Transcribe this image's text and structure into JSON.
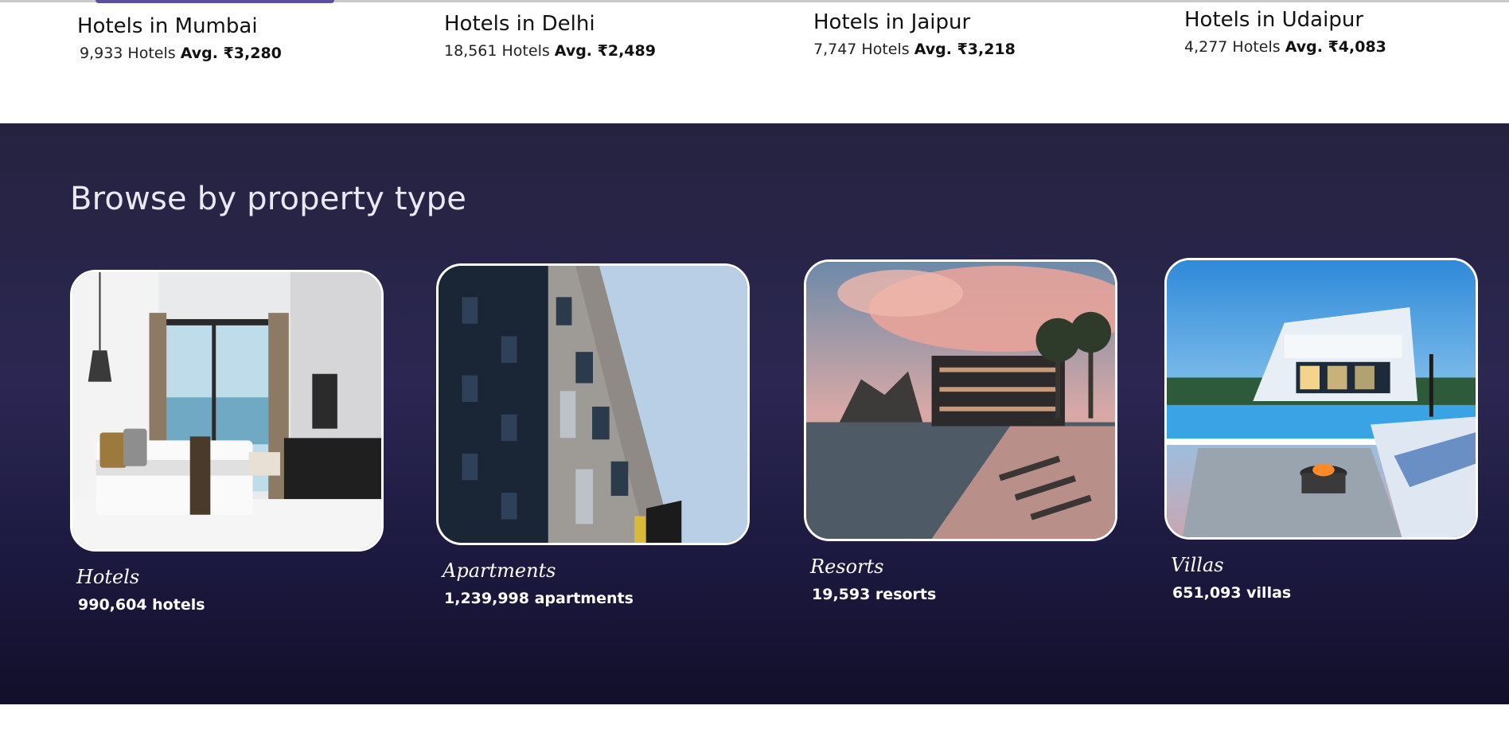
{
  "cities": [
    {
      "title": "Hotels in Mumbai",
      "count": "9,933 Hotels",
      "avg": "Avg. ₹3,280"
    },
    {
      "title": "Hotels in Delhi",
      "count": "18,561 Hotels",
      "avg": "Avg. ₹2,489"
    },
    {
      "title": "Hotels in Jaipur",
      "count": "7,747 Hotels",
      "avg": "Avg. ₹3,218"
    },
    {
      "title": "Hotels in Udaipur",
      "count": "4,277 Hotels",
      "avg": "Avg. ₹4,083"
    }
  ],
  "browse": {
    "title": "Browse by property type",
    "types": [
      {
        "name": "Hotels",
        "count": "990,604 hotels"
      },
      {
        "name": "Apartments",
        "count": "1,239,998 apartments"
      },
      {
        "name": "Resorts",
        "count": "19,593 resorts"
      },
      {
        "name": "Villas",
        "count": "651,093 villas"
      }
    ]
  },
  "colors": {
    "band_top": "#25223f",
    "band_bottom": "#120f2a",
    "card_border": "#ffffff"
  }
}
